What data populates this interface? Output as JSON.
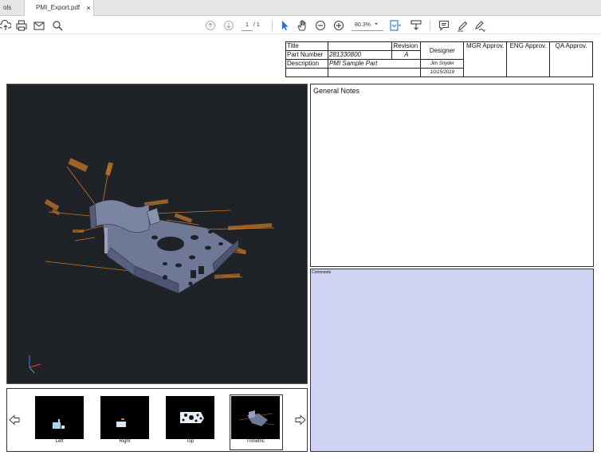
{
  "tabs": {
    "tools_label": "ols",
    "active_label": "PMI_Export.pdf",
    "close_glyph": "×"
  },
  "toolbar": {
    "icons": [
      "upload-icon",
      "print-icon",
      "mail-icon",
      "search-icon",
      "page-up-icon",
      "page-down-icon",
      "select-arrow-icon",
      "hand-icon",
      "zoom-out-icon",
      "zoom-in-icon",
      "fit-page-icon",
      "scroll-icon",
      "comment-icon",
      "pen-icon",
      "sign-icon"
    ],
    "page_current": "1",
    "page_total": "/ 1",
    "zoom": "80.3%"
  },
  "title_block": {
    "title_label": "Title",
    "title_value": "",
    "part_number_label": "Part Number",
    "part_number_value": "281330800",
    "description_label": "Description",
    "description_value": "PMI Sample Part",
    "revision_label": "Revision",
    "revision_value": "A",
    "designer_label": "Designer",
    "designer_value": "Jim Snyder",
    "date_value": "10/15/2019",
    "mgr_label": "MGR Approv.",
    "eng_label": "ENG Approv.",
    "qa_label": "QA Approv."
  },
  "notes": {
    "general_title": "General Notes",
    "comments_title": "Comments"
  },
  "views": {
    "items": [
      {
        "label": "Left"
      },
      {
        "label": "Right"
      },
      {
        "label": "Top"
      },
      {
        "label": "Trimetric",
        "selected": true
      }
    ]
  },
  "colors": {
    "viewport_bg": "#1f2226",
    "comments_bg": "#cfd3f4",
    "annotation": "#c97a2a",
    "part": "#6f7894"
  }
}
